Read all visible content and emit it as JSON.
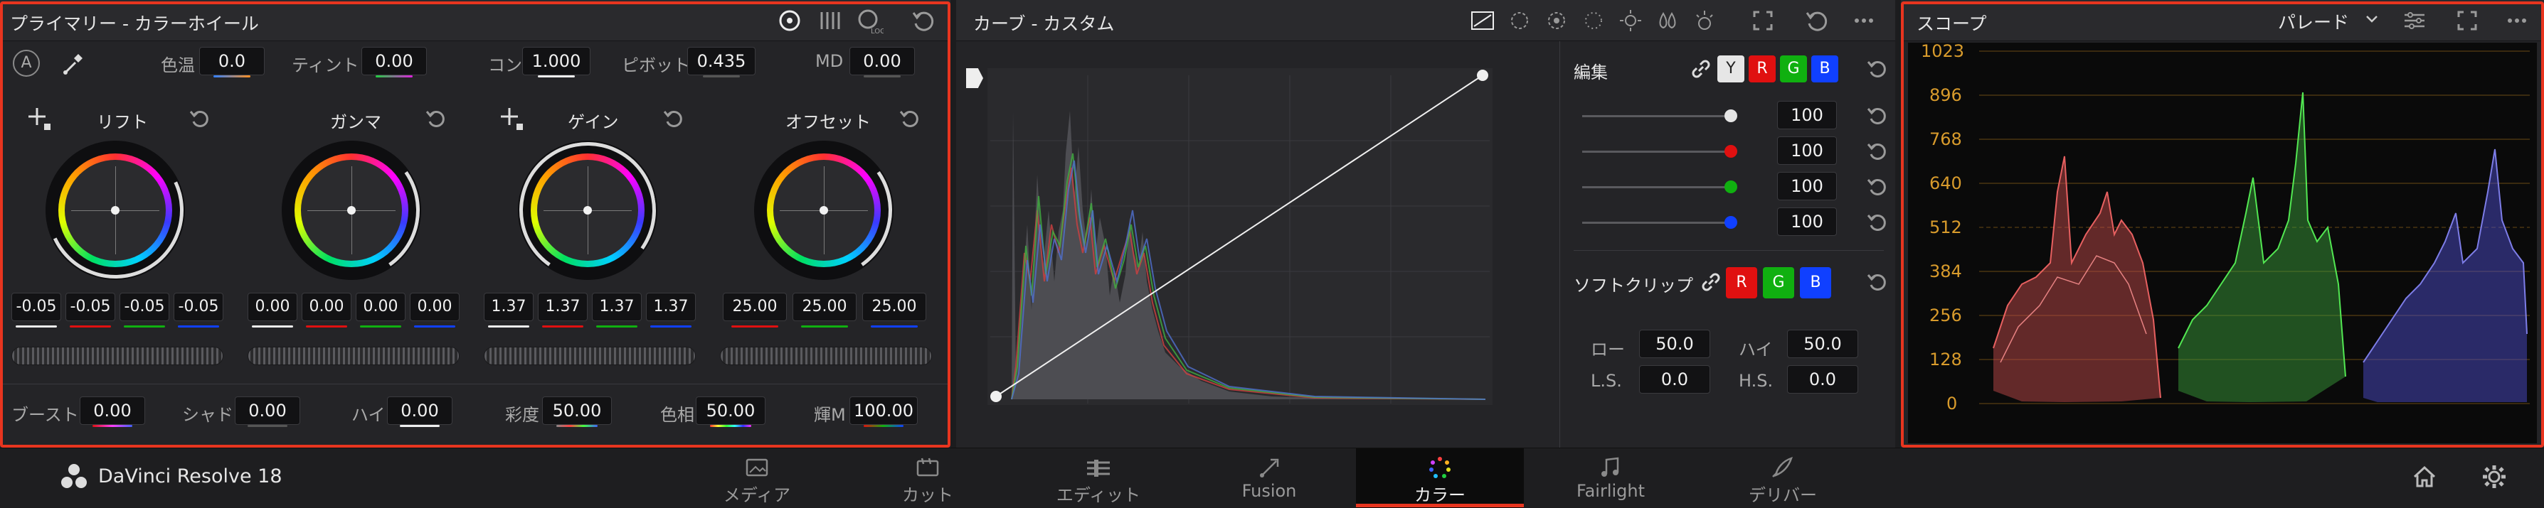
{
  "primary": {
    "title": "プライマリー - カラーホイール",
    "auto_label": "A",
    "top": [
      {
        "label": "色温",
        "value": "0.0"
      },
      {
        "label": "ティント",
        "value": "0.00"
      },
      {
        "label": "コン",
        "value": "1.000"
      },
      {
        "label": "ピボット",
        "value": "0.435"
      },
      {
        "label": "MD",
        "value": "0.00"
      }
    ],
    "wheels": [
      {
        "label": "リフト",
        "values": [
          "-0.05",
          "-0.05",
          "-0.05",
          "-0.05"
        ]
      },
      {
        "label": "ガンマ",
        "values": [
          "0.00",
          "0.00",
          "0.00",
          "0.00"
        ]
      },
      {
        "label": "ゲイン",
        "values": [
          "1.37",
          "1.37",
          "1.37",
          "1.37"
        ]
      },
      {
        "label": "オフセット",
        "values": [
          "25.00",
          "25.00",
          "25.00"
        ]
      }
    ],
    "bottom": [
      {
        "label": "ブースト",
        "value": "0.00"
      },
      {
        "label": "シャド",
        "value": "0.00"
      },
      {
        "label": "ハイ",
        "value": "0.00"
      },
      {
        "label": "彩度",
        "value": "50.00"
      },
      {
        "label": "色相",
        "value": "50.00"
      },
      {
        "label": "輝M",
        "value": "100.00"
      }
    ]
  },
  "curves": {
    "title": "カーブ - カスタム",
    "edit_label": "編集",
    "channels": [
      "Y",
      "R",
      "G",
      "B"
    ],
    "intensities": [
      "100",
      "100",
      "100",
      "100"
    ],
    "softclip_label": "ソフトクリップ",
    "softclip_channels": [
      "R",
      "G",
      "B"
    ],
    "low_label": "ロー",
    "low_value": "50.0",
    "high_label": "ハイ",
    "high_value": "50.0",
    "ls_label": "L.S.",
    "ls_value": "0.0",
    "hs_label": "H.S.",
    "hs_value": "0.0"
  },
  "scope": {
    "title": "スコープ",
    "mode": "パレード",
    "ticks": [
      "1023",
      "896",
      "768",
      "640",
      "512",
      "384",
      "256",
      "128",
      "0"
    ]
  },
  "bottom_bar": {
    "app_name": "DaVinci Resolve 18",
    "pages": [
      "メディア",
      "カット",
      "エディット",
      "Fusion",
      "カラー",
      "Fairlight",
      "デリバー"
    ],
    "active_page": "カラー"
  },
  "colors": {
    "accent": "#e8351f",
    "active_underline": "#e8351f",
    "red": "#e01010",
    "green": "#10b010",
    "blue": "#1040ff"
  }
}
